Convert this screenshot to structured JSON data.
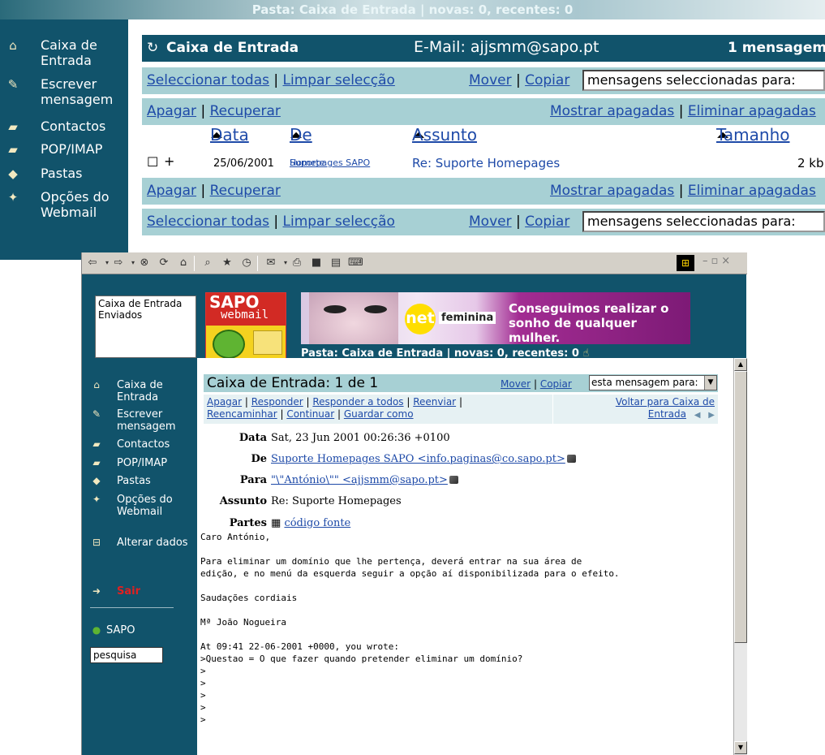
{
  "top_banner": {
    "text": "Pasta: Caixa de Entrada | novas: 0, recentes: 0"
  },
  "top_sidebar": {
    "items": [
      {
        "label": "Caixa de Entrada",
        "icon": "home-icon"
      },
      {
        "label": "Escrever mensagem",
        "icon": "write-icon"
      },
      {
        "label": "Contactos",
        "icon": "book-icon"
      },
      {
        "label": "POP/IMAP",
        "icon": "book-icon"
      },
      {
        "label": "Pastas",
        "icon": "folder-icon"
      },
      {
        "label": "Opções do Webmail",
        "icon": "options-icon"
      }
    ]
  },
  "top_panel": {
    "title": "Caixa de Entrada",
    "email_label": "E-Mail: ajjsmm@sapo.pt",
    "message_count": "1 mensagem",
    "select_all": "Seleccionar todas",
    "clear_selection": "Limpar selecção",
    "move": "Mover",
    "copy": "Copiar",
    "target_select": "mensagens seleccionadas para:",
    "delete": "Apagar",
    "recover": "Recuperar",
    "show_deleted": "Mostrar apagadas",
    "remove_deleted": "Eliminar apagadas",
    "columns": {
      "date": "Data",
      "from": "De",
      "subject": "Assunto",
      "size": "Tamanho"
    },
    "message": {
      "date": "25/06/2001",
      "from_line1": "Suporte",
      "from_line2": "Homepages SAPO",
      "subject": "Re: Suporte Homepages",
      "size": "2 kb"
    }
  },
  "browser": {
    "folders": [
      "Caixa de Entrada",
      "Enviados"
    ],
    "logo": {
      "sapo": "SAPO",
      "webmail": "webmail"
    },
    "banner": {
      "net": "net",
      "brand": "feminina",
      "slogan_line1": "Conseguimos realizar o",
      "slogan_line2": "sonho de qualquer mulher."
    },
    "status": "Pasta: Caixa de Entrada | novas: 0, recentes: 0",
    "sidebar": {
      "items": [
        {
          "label": "Caixa de Entrada",
          "icon": "home-icon"
        },
        {
          "label": "Escrever mensagem",
          "icon": "write-icon"
        },
        {
          "label": "Contactos",
          "icon": "book-icon"
        },
        {
          "label": "POP/IMAP",
          "icon": "book-icon"
        },
        {
          "label": "Pastas",
          "icon": "folder-icon"
        },
        {
          "label": "Opções do Webmail",
          "icon": "options-icon"
        },
        {
          "label": "Alterar dados",
          "icon": "lock-icon"
        }
      ],
      "logout": "Sair",
      "sapo": "SAPO",
      "search_value": "pesquisa"
    },
    "message": {
      "title": "Caixa de Entrada: 1 de 1",
      "move": "Mover",
      "copy": "Copiar",
      "target_select": "esta mensagem para:",
      "actions": {
        "delete": "Apagar",
        "reply": "Responder",
        "reply_all": "Responder a todos",
        "resend": "Reenviar",
        "forward": "Reencaminhar",
        "continue": "Continuar",
        "save_as": "Guardar como"
      },
      "back_line1": "Voltar para Caixa de",
      "back_line2": "Entrada",
      "headers": {
        "date_label": "Data",
        "date_value": "Sat, 23 Jun 2001 00:26:36 +0100",
        "from_label": "De",
        "from_value": "Suporte Homepages SAPO <info.paginas@co.sapo.pt>",
        "to_label": "Para",
        "to_value": "\"\\\"António\\\"\" <ajjsmm@sapo.pt>",
        "subject_label": "Assunto",
        "subject_value": "Re: Suporte Homepages",
        "parts_label": "Partes",
        "parts_value": "código fonte"
      },
      "body": "Caro António,\n\nPara eliminar um domínio que lhe pertença, deverá entrar na sua área de\nedição, e no menú da esquerda seguir a opção aí disponibilizada para o efeito.\n\nSaudações cordiais\n\nMª João Nogueira\n\nAt 09:41 22-06-2001 +0000, you wrote:\n>Questao = O que fazer quando pretender eliminar um domínio?\n>\n>\n>\n>\n>"
    }
  },
  "colors": {
    "sidebar": "#11536b",
    "light_bar": "#a7d0d4",
    "link": "#1e4aa8",
    "logout": "#e02020"
  }
}
